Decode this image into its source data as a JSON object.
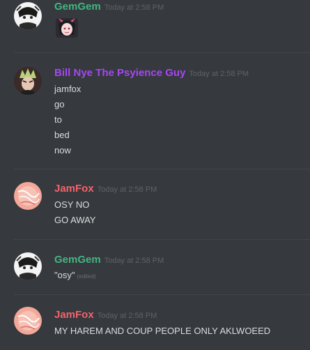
{
  "colors": {
    "background": "#36393e",
    "gemgem": "#43b581",
    "billnye": "#a548f2",
    "jamfox": "#f1646b",
    "message_text": "#dcddde",
    "timestamp": "#5f6368"
  },
  "messages": [
    {
      "author": "GemGem",
      "timestamp": "Today at 2:58 PM",
      "avatar_icon": "manga-character-avatar-icon",
      "attachment_icon": "anime-girl-emoji-icon"
    },
    {
      "author": "Bill Nye The Psyience Guy",
      "timestamp": "Today at 2:58 PM",
      "avatar_icon": "spiky-hair-character-avatar-icon",
      "lines": [
        "jamfox",
        "go",
        "to",
        "bed",
        "now"
      ]
    },
    {
      "author": "JamFox",
      "timestamp": "Today at 2:58 PM",
      "avatar_icon": "pink-sketch-avatar-icon",
      "lines": [
        "OSY NO",
        "GO AWAY"
      ]
    },
    {
      "author": "GemGem",
      "timestamp": "Today at 2:58 PM",
      "avatar_icon": "manga-character-avatar-icon",
      "lines": [
        "\"osy\""
      ],
      "edited_label": "(edited)"
    },
    {
      "author": "JamFox",
      "timestamp": "Today at 2:58 PM",
      "avatar_icon": "pink-sketch-avatar-icon",
      "lines": [
        "MY HAREM AND COUP PEOPLE ONLY AKLWOEED"
      ]
    }
  ]
}
